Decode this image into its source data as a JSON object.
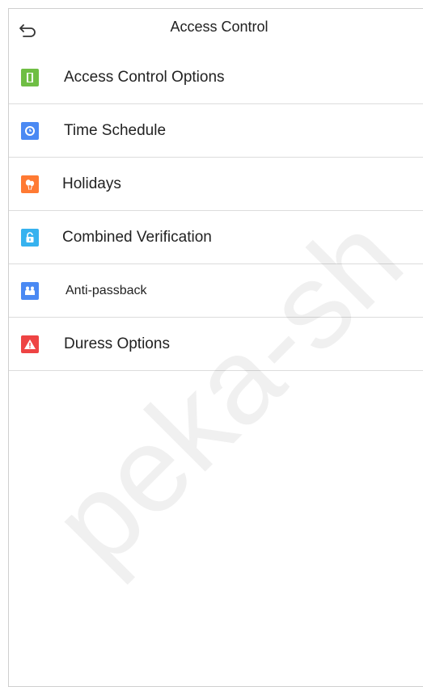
{
  "header": {
    "title": "Access Control",
    "back_icon": "back-arrow-icon"
  },
  "menu": {
    "items": [
      {
        "label": "Access Control Options",
        "icon": "door-icon",
        "color": "#6fbe44"
      },
      {
        "label": "Time Schedule",
        "icon": "clock-icon",
        "color": "#4a89f3"
      },
      {
        "label": "Holidays",
        "icon": "balloons-icon",
        "color": "#ff7a33"
      },
      {
        "label": "Combined Verification",
        "icon": "lock-open-icon",
        "color": "#36b2ef"
      },
      {
        "label": "Anti-passback",
        "icon": "people-icon",
        "color": "#4a89f3"
      },
      {
        "label": "Duress Options",
        "icon": "warning-icon",
        "color": "#ee4444"
      }
    ]
  },
  "watermark": {
    "text": "peka-sh"
  }
}
